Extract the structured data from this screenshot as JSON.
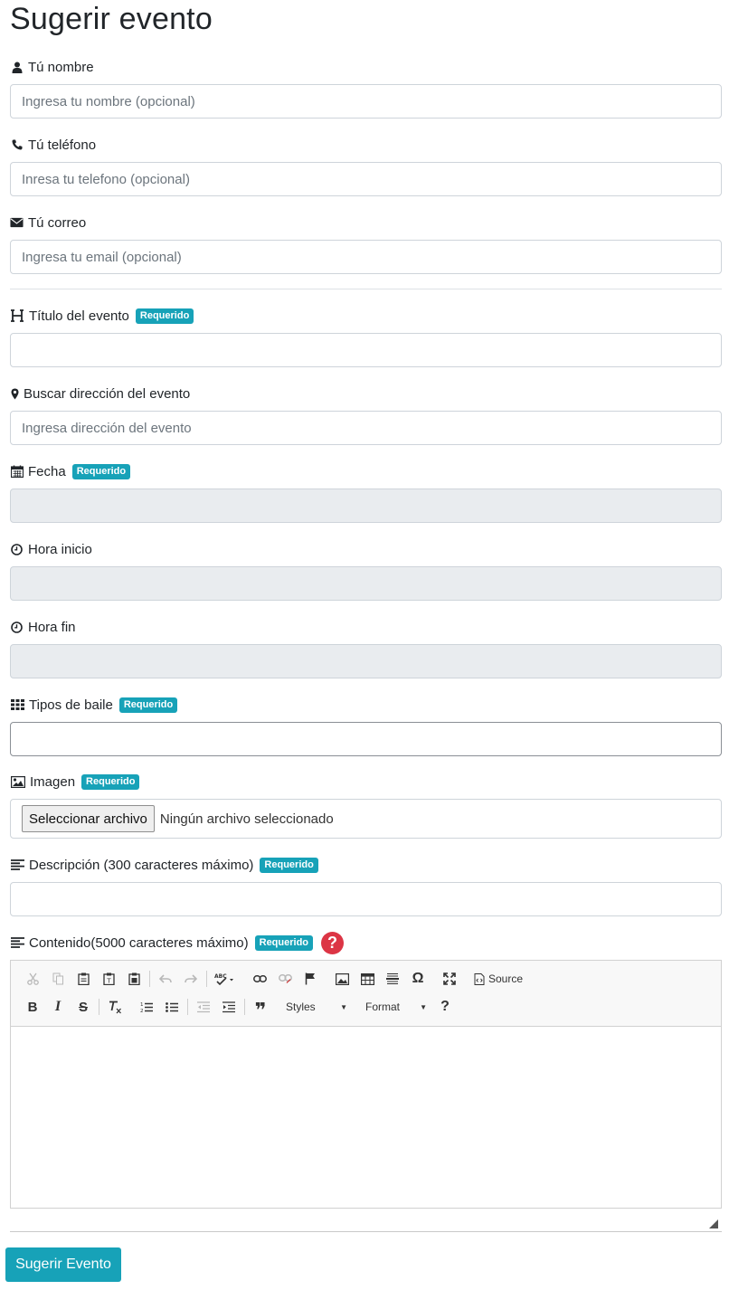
{
  "title": "Sugerir evento",
  "required_badge": "Requerido",
  "fields": {
    "nombre": {
      "label": "Tú nombre",
      "placeholder": "Ingresa tu nombre (opcional)",
      "icon": "user-icon"
    },
    "telefono": {
      "label": "Tú teléfono",
      "placeholder": "Inresa tu telefono (opcional)",
      "icon": "phone-icon"
    },
    "correo": {
      "label": "Tú correo",
      "placeholder": "Ingresa tu email (opcional)",
      "icon": "envelope-icon"
    },
    "titulo": {
      "label": "Título del evento",
      "placeholder": "",
      "icon": "heading-icon"
    },
    "direccion": {
      "label": "Buscar dirección del evento",
      "placeholder": "Ingresa dirección del evento",
      "icon": "map-marker-icon"
    },
    "fecha": {
      "label": "Fecha",
      "icon": "calendar-icon"
    },
    "hora_inicio": {
      "label": "Hora inicio",
      "icon": "clock-icon"
    },
    "hora_fin": {
      "label": "Hora fin",
      "icon": "clock-icon"
    },
    "tipos_baile": {
      "label": "Tipos de baile",
      "icon": "grid-icon"
    },
    "imagen": {
      "label": "Imagen",
      "icon": "image-icon",
      "button": "Seleccionar archivo",
      "status": "Ningún archivo seleccionado"
    },
    "descripcion": {
      "label": "Descripción (300 caracteres máximo)",
      "icon": "align-left-icon"
    },
    "contenido": {
      "label": "Contenido(5000 caracteres máximo)",
      "icon": "align-left-icon",
      "help": "?"
    }
  },
  "editor": {
    "source_label": "Source",
    "styles_label": "Styles",
    "format_label": "Format",
    "bold": "B",
    "italic": "I",
    "strike": "S",
    "help": "?",
    "omega": "Ω",
    "quote": "❞"
  },
  "submit_label": "Sugerir Evento",
  "colors": {
    "accent": "#17a2b8",
    "danger": "#dc3545"
  }
}
